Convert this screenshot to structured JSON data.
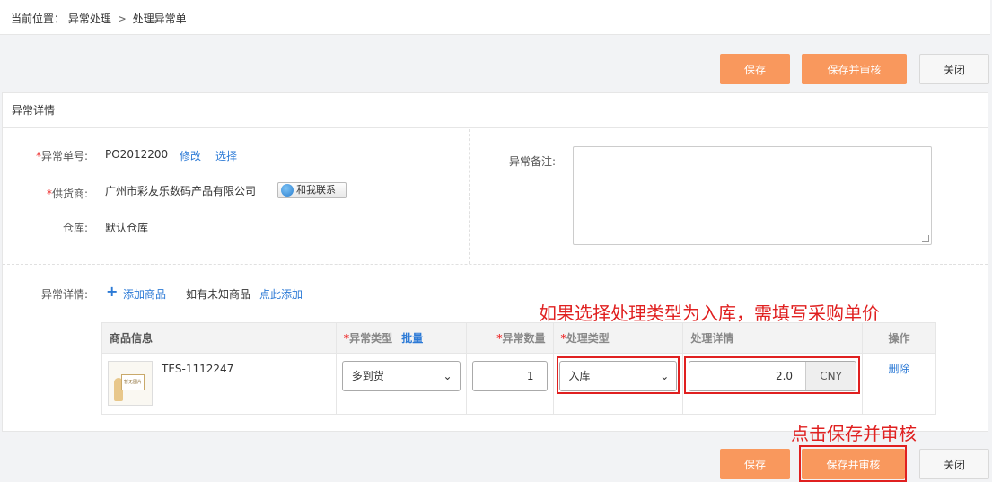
{
  "breadcrumb": {
    "prefix": "当前位置：",
    "level1": "异常处理",
    "sep": ">",
    "level2": "处理异常单"
  },
  "toolbar": {
    "save": "保存",
    "save_audit": "保存并审核",
    "close": "关闭"
  },
  "panel": {
    "title": "异常详情"
  },
  "form": {
    "order_no_label": "异常单号:",
    "order_no": "PO2012200",
    "edit": "修改",
    "choose": "选择",
    "supplier_label": "供货商:",
    "supplier": "广州市彩友乐数码产品有限公司",
    "contact": "和我联系",
    "warehouse_label": "仓库:",
    "warehouse": "默认仓库",
    "remark_label": "异常备注:",
    "remark_value": "",
    "details_label": "异常详情:",
    "add_goods": "添加商品",
    "unknown_hint": "如有未知商品",
    "click_add": "点此添加",
    "required_mark": "*"
  },
  "annotations": {
    "top": "如果选择处理类型为入库，需填写采购单价",
    "bottom": "点击保存并审核"
  },
  "table": {
    "headers": {
      "goods_info": "商品信息",
      "exception_type": "异常类型",
      "batch": "批量",
      "exception_qty": "异常数量",
      "process_type": "处理类型",
      "process_detail": "处理详情",
      "action": "操作"
    },
    "row": {
      "sku": "TES-1112247",
      "thumb_text": "暂无图片",
      "exception_type": "多到货",
      "qty": "1",
      "process_type": "入库",
      "price": "2.0",
      "currency": "CNY",
      "delete": "删除"
    }
  },
  "colors": {
    "accent": "#f9985d",
    "link": "#2c7ad6",
    "annotation": "#e02020"
  },
  "icons": {
    "plus": "plus-icon",
    "qq": "qq-icon",
    "chevron": "chevron-down-icon"
  }
}
